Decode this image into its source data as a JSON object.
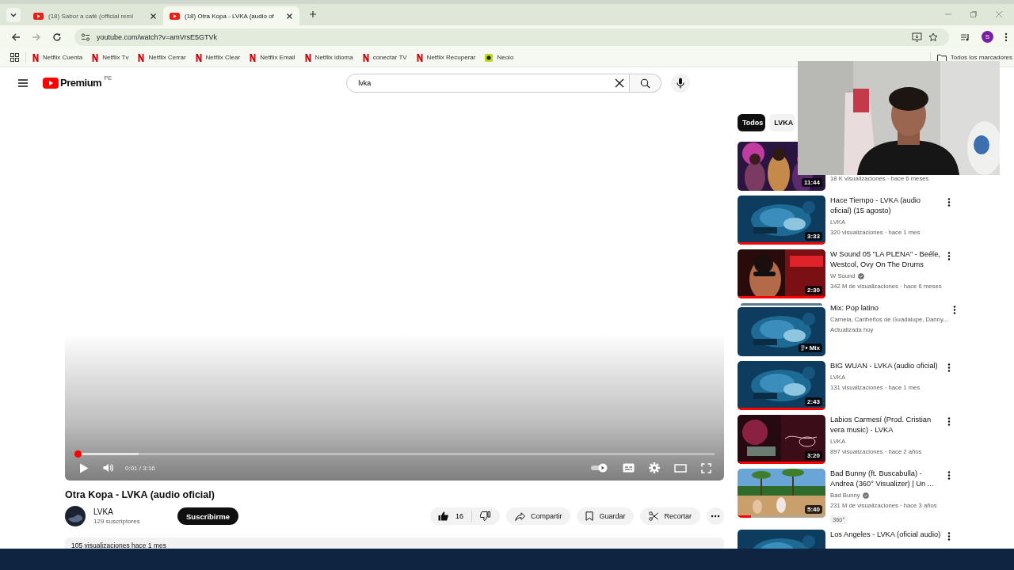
{
  "browser": {
    "tabs": [
      {
        "title": "(18) Sabor a café (official remi",
        "selected": false
      },
      {
        "title": "(18) Otra Kopa - LVKA (audio of",
        "selected": true
      }
    ],
    "url": "youtube.com/watch?v=amVrsE5GTVk",
    "profile_initial": "S",
    "bookmarks": [
      {
        "label": "Netflix Cuenta",
        "kind": "netflix"
      },
      {
        "label": "Netflix Tv",
        "kind": "netflix"
      },
      {
        "label": "Netflix Cerrar",
        "kind": "netflix"
      },
      {
        "label": "Netflix Clear",
        "kind": "netflix"
      },
      {
        "label": "Netflix Email",
        "kind": "netflix"
      },
      {
        "label": "Netflix idioma",
        "kind": "netflix"
      },
      {
        "label": "conectar TV",
        "kind": "netflix"
      },
      {
        "label": "Netflix Recuperar",
        "kind": "netflix"
      },
      {
        "label": "Neolo",
        "kind": "neolo"
      }
    ],
    "all_bookmarks": "Todos los marcadores"
  },
  "masthead": {
    "logo": "Premium",
    "region": "PE",
    "search": {
      "value": "lvka"
    }
  },
  "player": {
    "level": 0.005,
    "buffer": {
      "level": 0.1
    },
    "time": "0:01 / 3:16"
  },
  "video": {
    "title": "Otra Kopa - LVKA (audio oficial)",
    "channel": "LVKA",
    "subscribers": "129 suscriptores",
    "subscribe": "Suscribirme",
    "likes": "16",
    "actions": [
      {
        "label": "Compartir",
        "kind": "share"
      },
      {
        "label": "Guardar",
        "kind": "save"
      },
      {
        "label": "Recortar",
        "kind": "clip"
      }
    ],
    "description": "105 visualizaciones  hace 1 mes"
  },
  "chips": [
    {
      "label": "Todos",
      "selected": true
    },
    {
      "label": "LVKA",
      "selected": false
    }
  ],
  "related": [
    {
      "kind": "video",
      "meta": "18 K visualizaciones · hace 6 meses",
      "duration": "11:44"
    },
    {
      "kind": "video",
      "title": "Hace Tiempo - LVKA (audio oficial) (15 agosto)",
      "channel": "LVKA",
      "meta": "320 visualizaciones · hace 1 mes",
      "duration": "3:33",
      "level": 1
    },
    {
      "kind": "video",
      "title": "W Sound 05 \"LA PLENA\" - Beéle, Westcol, Ovy On The Drums",
      "channel": "W Sound",
      "verified": true,
      "meta": "342 M de visualizaciones · hace 6 meses",
      "duration": "2:30",
      "level": 1
    },
    {
      "kind": "mix",
      "title": "Mix: Pop latino",
      "channel": "Camela, Caribeños de Guadalupe, Danny...",
      "meta": "Actualizada hoy",
      "duration": "Mix"
    },
    {
      "kind": "video",
      "title": "BIG WUAN - LVKA (audio oficial)",
      "channel": "LVKA",
      "meta": "131 visualizaciones · hace 1 mes",
      "duration": "2:43",
      "level": 1
    },
    {
      "kind": "video",
      "title": "Labios Carmesí (Prod. Cristian vera music) - LVKA",
      "channel": "LVKA",
      "meta": "897 visualizaciones · hace 2 años",
      "duration": "3:20",
      "level": 1
    },
    {
      "kind": "video",
      "title": "Bad Bunny (ft. Buscabulla) - Andrea (360° Visualizer) | Un ...",
      "channel": "Bad Bunny",
      "verified": true,
      "meta": "231 M de visualizaciones · hace 3 años",
      "badge": "360°",
      "duration": "5:40",
      "level": 0.15
    },
    {
      "kind": "video",
      "title": "Los Angeles - LVKA (oficial audio)"
    }
  ]
}
